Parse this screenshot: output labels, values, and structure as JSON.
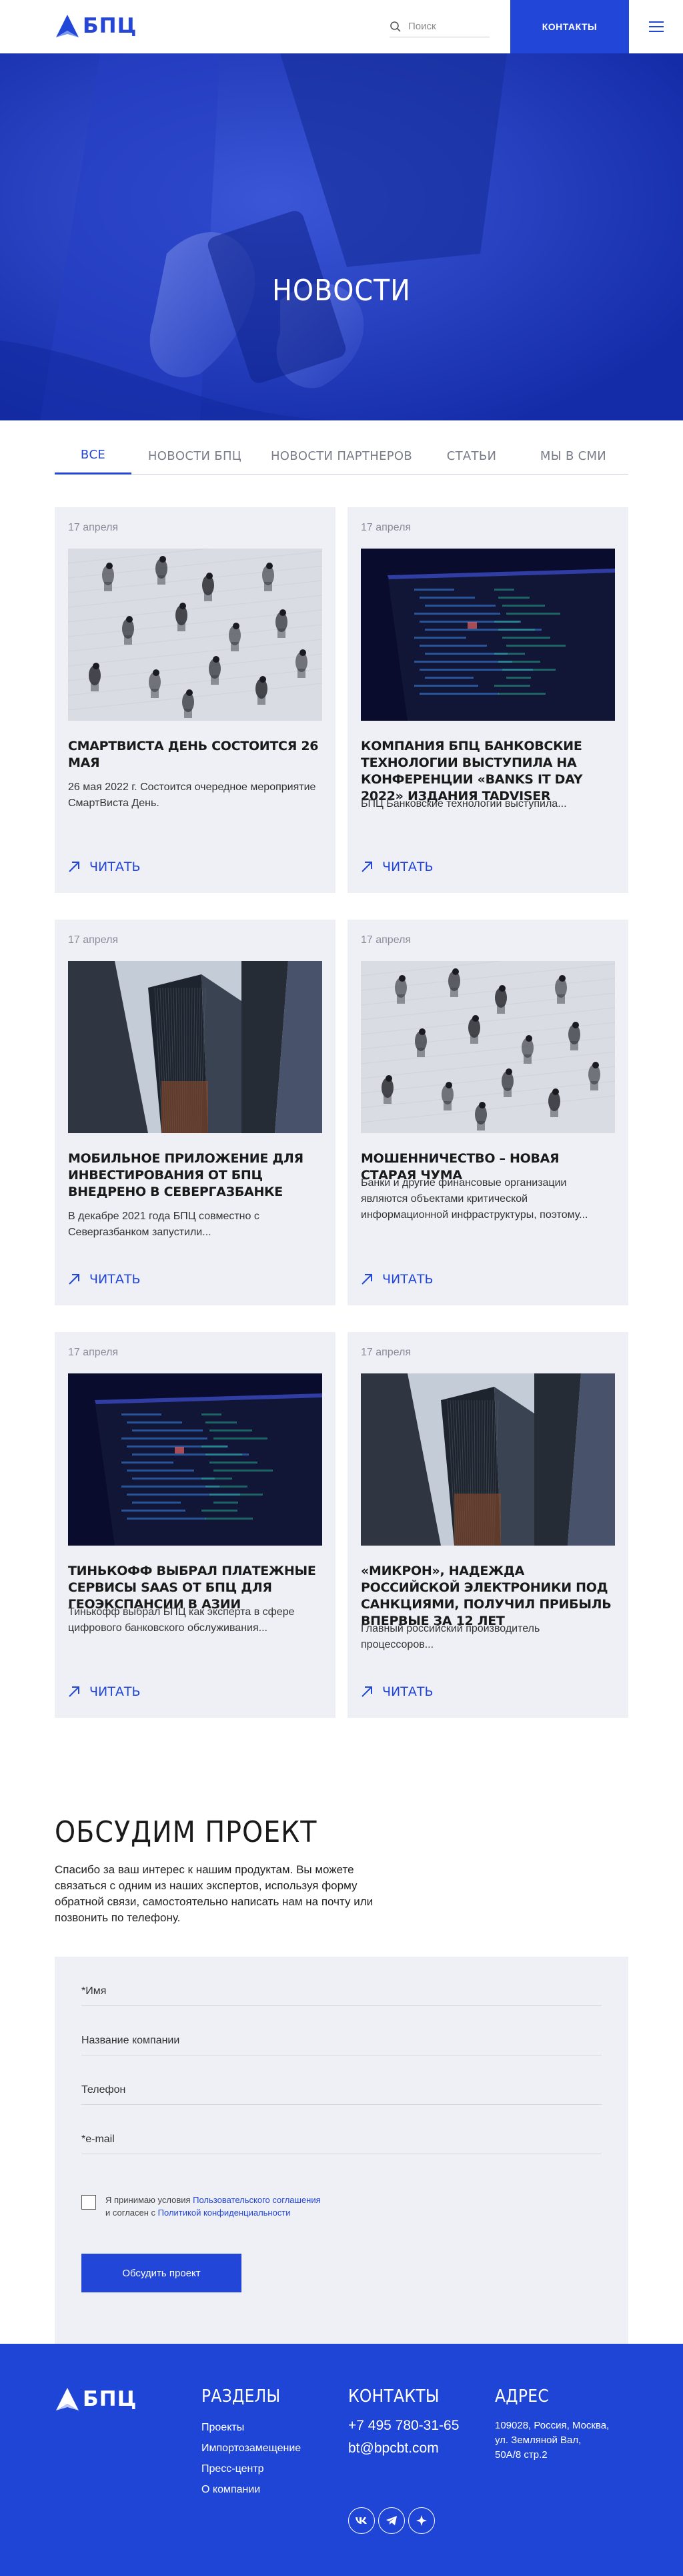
{
  "header": {
    "logo_text": "БПЦ",
    "search_placeholder": "Поиск",
    "contacts_label": "Контакты"
  },
  "hero": {
    "title": "НОВОСТИ"
  },
  "tabs": [
    {
      "label": "ВСЕ",
      "active": true
    },
    {
      "label": "НОВОСТИ БПЦ",
      "active": false
    },
    {
      "label": "НОВОСТИ ПАРТНЕРОВ",
      "active": false
    },
    {
      "label": "СТАТЬИ",
      "active": false
    },
    {
      "label": "МЫ В СМИ",
      "active": false
    }
  ],
  "news": [
    {
      "date": "17 апреля",
      "title": "СМАРТВИСТА ДЕНЬ СОСТОИТСЯ 26 МАЯ",
      "text": "26 мая 2022 г. Состоится очередное мероприятие СмартВиста День.",
      "read": "ЧИТАТЬ",
      "image": "crowd"
    },
    {
      "date": "17 апреля",
      "title": "КОМПАНИЯ БПЦ БАНКОВСКИЕ ТЕХНОЛОГИИ ВЫСТУПИЛА НА КОНФЕРЕНЦИИ «BANKS IT DAY 2022» ИЗДАНИЯ TADVISER",
      "text": "БПЦ Банковские технологии выступила...",
      "read": "ЧИТАТЬ",
      "image": "screen"
    },
    {
      "date": "17 апреля",
      "title": "МОБИЛЬНОЕ ПРИЛОЖЕНИЕ ДЛЯ ИНВЕСТИРОВАНИЯ ОТ БПЦ ВНЕДРЕНО В СЕВЕРГАЗБАНКЕ",
      "text": "В декабре 2021 года БПЦ совместно с Севергазбанком запустили...",
      "read": "ЧИТАТЬ",
      "image": "towers"
    },
    {
      "date": "17 апреля",
      "title": "МОШЕННИЧЕСТВО – НОВАЯ СТАРАЯ ЧУМА",
      "text": "Банки и другие финансовые организации являются объектами критической информационной инфраструктуры, поэтому...",
      "read": "ЧИТАТЬ",
      "image": "crowd"
    },
    {
      "date": "17 апреля",
      "title": "ТИНЬКОФФ ВЫБРАЛ ПЛАТЕЖНЫЕ СЕРВИСЫ SAAS ОТ БПЦ ДЛЯ ГЕОЭКСПАНСИИ В АЗИИ",
      "text": "Тинькофф выбрал БПЦ как эксперта в сфере цифрового банковского обслуживания...",
      "read": "ЧИТАТЬ",
      "image": "screen"
    },
    {
      "date": "17 апреля",
      "title": "«МИКРОН», НАДЕЖДА РОССИЙСКОЙ ЭЛЕКТРОНИКИ ПОД САНКЦИЯМИ, ПОЛУЧИЛ ПРИБЫЛЬ ВПЕРВЫЕ ЗА 12 ЛЕТ",
      "text": "Главный российский производитель процессоров...",
      "read": "ЧИТАТЬ",
      "image": "towers"
    }
  ],
  "discuss": {
    "title": "ОБСУДИМ ПРОЕКТ",
    "text": "Спасибо за ваш интерес к нашим продуктам. Вы можете связаться с одним из наших экспертов, используя форму обратной связи, самостоятельно написать нам на почту или позвонить по телефону."
  },
  "form": {
    "name_label": "*Имя",
    "company_label": "Название компании",
    "phone_label": "Телефон",
    "email_label": "*e-mail",
    "agree_prefix": "Я принимаю условия ",
    "agree_link1": "Пользовательского соглашения",
    "agree_mid": "и согласен с ",
    "agree_link2": "Политикой конфиденциальности",
    "submit_label": "Обсудить проект"
  },
  "footer": {
    "logo_text": "БПЦ",
    "sections_title": "РАЗДЕЛЫ",
    "sections": [
      "Проекты",
      "Импортозамещение",
      "Пресс-центр",
      "О компании"
    ],
    "contacts_title": "КОНТАКТЫ",
    "phone": "+7 495 780-31-65",
    "email": "bt@bpcbt.com",
    "address_title": "АДРЕС",
    "address": [
      "109028, Россия, Москва,",
      "ул. Земляной Вал,",
      "50А/8 стр.2"
    ],
    "social": [
      "vk",
      "telegram",
      "other"
    ]
  },
  "colors": {
    "brand": "#2246d8",
    "card_bg": "#eef0f6",
    "footer": "#1f45d6"
  }
}
